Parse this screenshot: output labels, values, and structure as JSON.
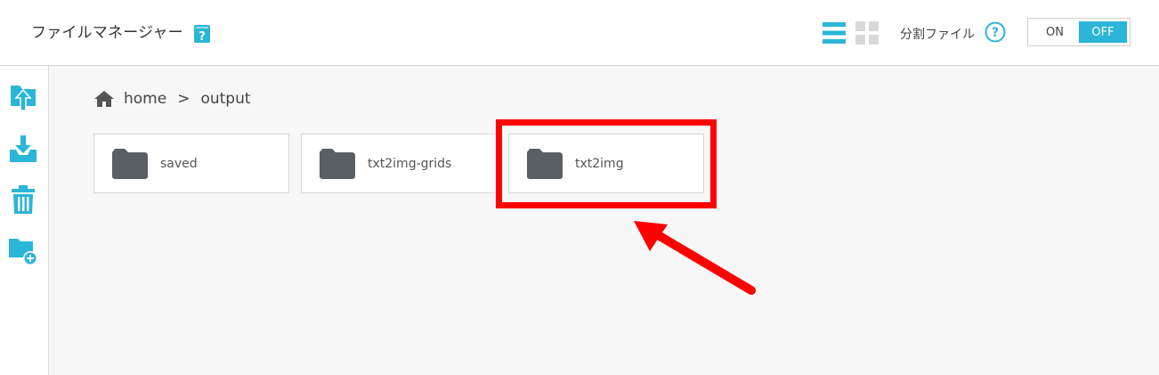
{
  "header": {
    "title": "ファイルマネージャー",
    "split_label": "分割ファイル",
    "toggle": {
      "on_label": "ON",
      "off_label": "OFF",
      "selected": "OFF"
    }
  },
  "sidebar": {
    "items": [
      {
        "name": "upload",
        "icon": "upload-icon"
      },
      {
        "name": "download",
        "icon": "download-icon"
      },
      {
        "name": "delete",
        "icon": "trash-icon"
      },
      {
        "name": "new-folder",
        "icon": "folder-add-icon"
      }
    ]
  },
  "breadcrumb": {
    "items": [
      "home",
      "output"
    ],
    "separator": ">"
  },
  "folders": [
    {
      "name": "saved"
    },
    {
      "name": "txt2img-grids"
    },
    {
      "name": "txt2img"
    }
  ],
  "colors": {
    "accent": "#2bb5d8",
    "folder": "#5a5f63",
    "highlight": "#ff0000"
  }
}
